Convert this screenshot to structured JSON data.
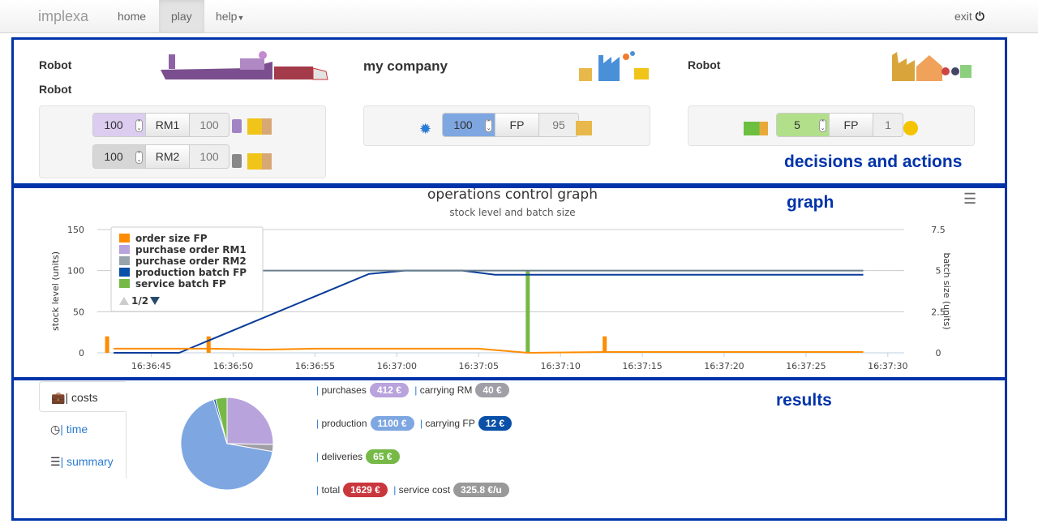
{
  "nav": {
    "brand": "implexa",
    "items": [
      "home",
      "play",
      "help"
    ],
    "active": "play",
    "exit": "exit"
  },
  "decisions": {
    "section_label": "decisions and actions",
    "supplier": {
      "names": [
        "Robot",
        "Robot"
      ],
      "rows": [
        {
          "value": "100",
          "item": "RM1",
          "stock": "100",
          "color": "#dccdf0"
        },
        {
          "value": "100",
          "item": "RM2",
          "stock": "100",
          "color": "#d6d6d6"
        }
      ]
    },
    "company": {
      "name": "my company",
      "value": "100",
      "item": "FP",
      "stock": "95",
      "color": "#7ea7e2"
    },
    "customer": {
      "name": "Robot",
      "value": "5",
      "item": "FP",
      "stock": "1",
      "color": "#b2df8a"
    }
  },
  "graph": {
    "section_label": "graph"
  },
  "chart_data": {
    "type": "line",
    "title": "operations control graph",
    "subtitle": "stock level and batch size",
    "ylabel": "stock level (units)",
    "y2label": "batch size (units)",
    "ylim": [
      0,
      150
    ],
    "y2lim": [
      0,
      7.5
    ],
    "yticks": [
      "0",
      "50",
      "100",
      "150"
    ],
    "y2ticks": [
      "0",
      "2.5",
      "5",
      "7.5"
    ],
    "xticks": [
      "16:36:45",
      "16:36:50",
      "16:36:55",
      "16:37:00",
      "16:37:05",
      "16:37:10",
      "16:37:15",
      "16:37:20",
      "16:37:25",
      "16:37:30"
    ],
    "xlim": [
      "16:36:41.7",
      "16:37:31"
    ],
    "grid": true,
    "legend_position": "top-left",
    "legend_page": "1/2",
    "legend": [
      {
        "name": "order size FP",
        "color": "#ff8c00"
      },
      {
        "name": "purchase order RM1",
        "color": "#b8a3dc"
      },
      {
        "name": "purchase order RM2",
        "color": "#97a4ad"
      },
      {
        "name": "production batch FP",
        "color": "#0a50a8"
      },
      {
        "name": "service batch FP",
        "color": "#76b947"
      }
    ],
    "lines": [
      {
        "color": "#0a3d99",
        "points": [
          [
            "16:36:42.7",
            0
          ],
          [
            "16:36:46.7",
            0
          ],
          [
            "16:36:58.3",
            96
          ],
          [
            "16:37:00.5",
            100
          ],
          [
            "16:37:04",
            100
          ],
          [
            "16:37:06",
            95
          ],
          [
            "16:37:28.5",
            95
          ]
        ]
      },
      {
        "color": "#6a7f8c",
        "points": [
          [
            "16:36:51",
            100
          ],
          [
            "16:37:28.5",
            100
          ]
        ]
      },
      {
        "color": "#ff8c00",
        "points": [
          [
            "16:36:42.7",
            5
          ],
          [
            "16:36:48.5",
            5
          ],
          [
            "16:36:52",
            4
          ],
          [
            "16:36:55",
            5
          ],
          [
            "16:37:05",
            5
          ],
          [
            "16:37:08",
            0
          ],
          [
            "16:37:12.7",
            1
          ],
          [
            "16:37:28.5",
            1
          ]
        ]
      }
    ],
    "bars": [
      {
        "x": "16:36:42.3",
        "value": 20,
        "color": "#ff8c00"
      },
      {
        "x": "16:36:48.5",
        "value": 20,
        "color": "#ff8c00"
      },
      {
        "x": "16:37:08",
        "value": 100,
        "color": "#76b947"
      },
      {
        "x": "16:37:12.7",
        "value": 20,
        "color": "#ff8c00"
      }
    ]
  },
  "results": {
    "section_label": "results",
    "tabs": [
      "costs",
      "time",
      "summary"
    ],
    "costs": [
      {
        "label": "purchases",
        "value": "412 €",
        "amount": 412,
        "color": "#b8a3dc"
      },
      {
        "label": "carrying RM",
        "value": "40 €",
        "amount": 40,
        "color": "#a09ea6"
      },
      {
        "label": "production",
        "value": "1100 €",
        "amount": 1100,
        "color": "#7ea7e2"
      },
      {
        "label": "carrying FP",
        "value": "12 €",
        "amount": 12,
        "color": "#0a50a8"
      },
      {
        "label": "deliveries",
        "value": "65 €",
        "amount": 65,
        "color": "#76b947"
      },
      {
        "label": "total",
        "value": "1629 €",
        "color": "#c9363c"
      },
      {
        "label": "service cost",
        "value": "325.8 €/u",
        "color": "#999999"
      }
    ]
  }
}
